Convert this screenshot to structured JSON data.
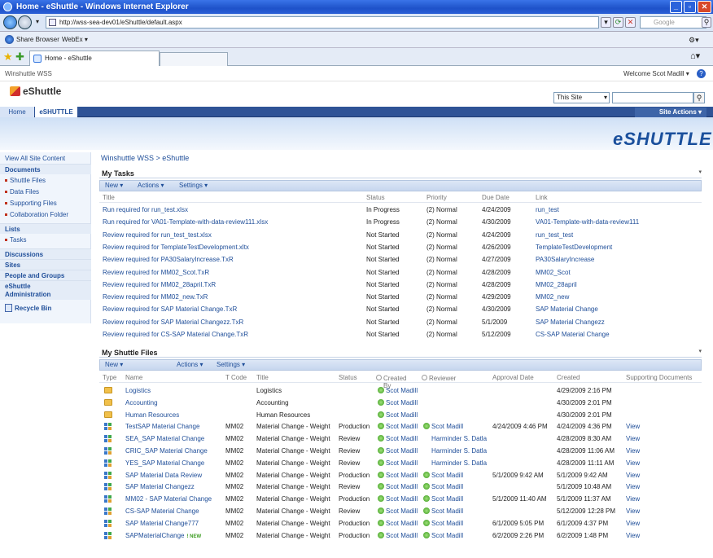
{
  "browser": {
    "title": "Home - eShuttle - Windows Internet Explorer",
    "url": "http://wss-sea-dev01/eShuttle/default.aspx",
    "search_placeholder": "Google",
    "links_bar": [
      "Share Browser",
      "WebEx ▾"
    ],
    "tab_title": "Home - eShuttle"
  },
  "site": {
    "parent_site": "Winshuttle WSS",
    "welcome": "Welcome Scot Madill ▾",
    "title": "eShuttle",
    "search_scope": "This Site",
    "nav": {
      "home": "Home",
      "current": "eSHUTTLE"
    },
    "site_actions": "Site Actions ▾",
    "brand": "eSHUTTLE"
  },
  "leftnav": {
    "view_all": "View All Site Content",
    "documents_head": "Documents",
    "documents": [
      "Shuttle Files",
      "Data Files",
      "Supporting Files",
      "Collaboration Folder"
    ],
    "lists_head": "Lists",
    "lists": [
      "Tasks"
    ],
    "discussions": "Discussions",
    "sites": "Sites",
    "people": "People and Groups",
    "admin_1": "eShuttle",
    "admin_2": "Administration",
    "recycle": "Recycle Bin"
  },
  "breadcrumb": "Winshuttle WSS > eShuttle",
  "tasks": {
    "title": "My Tasks",
    "toolbar": {
      "new": "New ▾",
      "actions": "Actions ▾",
      "settings": "Settings ▾"
    },
    "columns": {
      "title": "Title",
      "status": "Status",
      "priority": "Priority",
      "due": "Due Date",
      "link": "Link"
    },
    "rows": [
      {
        "title": "Run required for run_test.xlsx",
        "status": "In Progress",
        "priority": "(2) Normal",
        "due": "4/24/2009",
        "link": "run_test"
      },
      {
        "title": "Run required for VA01-Template-with-data-review111.xlsx",
        "status": "In Progress",
        "priority": "(2) Normal",
        "due": "4/30/2009",
        "link": "VA01-Template-with-data-review111"
      },
      {
        "title": "Review required for run_test_test.xlsx",
        "status": "Not Started",
        "priority": "(2) Normal",
        "due": "4/24/2009",
        "link": "run_test_test"
      },
      {
        "title": "Review required for TemplateTestDevelopment.xltx",
        "status": "Not Started",
        "priority": "(2) Normal",
        "due": "4/26/2009",
        "link": "TemplateTestDevelopment"
      },
      {
        "title": "Review required for PA30SalaryIncrease.TxR",
        "status": "Not Started",
        "priority": "(2) Normal",
        "due": "4/27/2009",
        "link": "PA30SalaryIncrease"
      },
      {
        "title": "Review required for MM02_Scot.TxR",
        "status": "Not Started",
        "priority": "(2) Normal",
        "due": "4/28/2009",
        "link": "MM02_Scot"
      },
      {
        "title": "Review required for MM02_28april.TxR",
        "status": "Not Started",
        "priority": "(2) Normal",
        "due": "4/28/2009",
        "link": "MM02_28april"
      },
      {
        "title": "Review required for MM02_new.TxR",
        "status": "Not Started",
        "priority": "(2) Normal",
        "due": "4/29/2009",
        "link": "MM02_new"
      },
      {
        "title": "Review required for SAP Material Change.TxR",
        "status": "Not Started",
        "priority": "(2) Normal",
        "due": "4/30/2009",
        "link": "SAP Material Change"
      },
      {
        "title": "Review required for SAP Material Changezz.TxR",
        "status": "Not Started",
        "priority": "(2) Normal",
        "due": "5/1/2009",
        "link": "SAP Material Changezz"
      },
      {
        "title": "Review required for CS-SAP Material Change.TxR",
        "status": "Not Started",
        "priority": "(2) Normal",
        "due": "5/12/2009",
        "link": "CS-SAP Material Change"
      }
    ]
  },
  "files": {
    "title": "My Shuttle Files",
    "toolbar": {
      "new": "New ▾",
      "actions": "Actions ▾",
      "settings": "Settings ▾"
    },
    "columns": {
      "type": "Type",
      "name": "Name",
      "tcode": "T Code",
      "title": "Title",
      "status": "Status",
      "created_by": "Created By",
      "reviewer": "Reviewer",
      "approval": "Approval Date",
      "created": "Created",
      "supporting": "Supporting Documents"
    },
    "rows": [
      {
        "kind": "folder",
        "name": "Logistics",
        "tcode": "",
        "title": "Logistics",
        "status": "",
        "created_by": "Scot Madill",
        "reviewer": "",
        "reviewer_presence": false,
        "approval": "",
        "created": "4/29/2009 2:16 PM",
        "supporting": "",
        "new": ""
      },
      {
        "kind": "folder",
        "name": "Accounting",
        "tcode": "",
        "title": "Accounting",
        "status": "",
        "created_by": "Scot Madill",
        "reviewer": "",
        "reviewer_presence": false,
        "approval": "",
        "created": "4/30/2009 2:01 PM",
        "supporting": "",
        "new": ""
      },
      {
        "kind": "folder",
        "name": "Human Resources",
        "tcode": "",
        "title": "Human Resources",
        "status": "",
        "created_by": "Scot Madill",
        "reviewer": "",
        "reviewer_presence": false,
        "approval": "",
        "created": "4/30/2009 2:01 PM",
        "supporting": "",
        "new": ""
      },
      {
        "kind": "file",
        "name": "TestSAP Material Change",
        "tcode": "MM02",
        "title": "Material Change - Weight",
        "status": "Production",
        "created_by": "Scot Madill",
        "reviewer": "Scot Madill",
        "reviewer_presence": true,
        "approval": "4/24/2009 4:46 PM",
        "created": "4/24/2009 4:36 PM",
        "supporting": "View",
        "new": ""
      },
      {
        "kind": "file",
        "name": "SEA_SAP Material Change",
        "tcode": "MM02",
        "title": "Material Change - Weight",
        "status": "Review",
        "created_by": "Scot Madill",
        "reviewer": "Harminder S. Datla",
        "reviewer_presence": false,
        "approval": "",
        "created": "4/28/2009 8:30 AM",
        "supporting": "View",
        "new": ""
      },
      {
        "kind": "file",
        "name": "CRIC_SAP Material Change",
        "tcode": "MM02",
        "title": "Material Change - Weight",
        "status": "Review",
        "created_by": "Scot Madill",
        "reviewer": "Harminder S. Datla",
        "reviewer_presence": false,
        "approval": "",
        "created": "4/28/2009 11:06 AM",
        "supporting": "View",
        "new": ""
      },
      {
        "kind": "file",
        "name": "YES_SAP Material Change",
        "tcode": "MM02",
        "title": "Material Change - Weight",
        "status": "Review",
        "created_by": "Scot Madill",
        "reviewer": "Harminder S. Datla",
        "reviewer_presence": false,
        "approval": "",
        "created": "4/28/2009 11:11 AM",
        "supporting": "View",
        "new": ""
      },
      {
        "kind": "file",
        "name": "SAP Material Data Review",
        "tcode": "MM02",
        "title": "Material Change - Weight",
        "status": "Production",
        "created_by": "Scot Madill",
        "reviewer": "Scot Madill",
        "reviewer_presence": true,
        "approval": "5/1/2009 9:42 AM",
        "created": "5/1/2009 9:42 AM",
        "supporting": "View",
        "new": ""
      },
      {
        "kind": "file",
        "name": "SAP Material Changezz",
        "tcode": "MM02",
        "title": "Material Change - Weight",
        "status": "Review",
        "created_by": "Scot Madill",
        "reviewer": "Scot Madill",
        "reviewer_presence": true,
        "approval": "",
        "created": "5/1/2009 10:48 AM",
        "supporting": "View",
        "new": ""
      },
      {
        "kind": "file",
        "name": "MM02 - SAP Material Change",
        "tcode": "MM02",
        "title": "Material Change - Weight",
        "status": "Production",
        "created_by": "Scot Madill",
        "reviewer": "Scot Madill",
        "reviewer_presence": true,
        "approval": "5/1/2009 11:40 AM",
        "created": "5/1/2009 11:37 AM",
        "supporting": "View",
        "new": ""
      },
      {
        "kind": "file",
        "name": "CS-SAP Material Change",
        "tcode": "MM02",
        "title": "Material Change - Weight",
        "status": "Review",
        "created_by": "Scot Madill",
        "reviewer": "Scot Madill",
        "reviewer_presence": true,
        "approval": "",
        "created": "5/12/2009 12:28 PM",
        "supporting": "View",
        "new": ""
      },
      {
        "kind": "file",
        "name": "SAP Material Change777",
        "tcode": "MM02",
        "title": "Material Change - Weight",
        "status": "Production",
        "created_by": "Scot Madill",
        "reviewer": "Scot Madill",
        "reviewer_presence": true,
        "approval": "6/1/2009 5:05 PM",
        "created": "6/1/2009 4:37 PM",
        "supporting": "View",
        "new": ""
      },
      {
        "kind": "file",
        "name": "SAPMaterialChange",
        "tcode": "MM02",
        "title": "Material Change - Weight",
        "status": "Production",
        "created_by": "Scot Madill",
        "reviewer": "Scot Madill",
        "reviewer_presence": true,
        "approval": "6/2/2009 2:26 PM",
        "created": "6/2/2009 1:48 PM",
        "supporting": "View",
        "new": "! NEW"
      }
    ]
  }
}
